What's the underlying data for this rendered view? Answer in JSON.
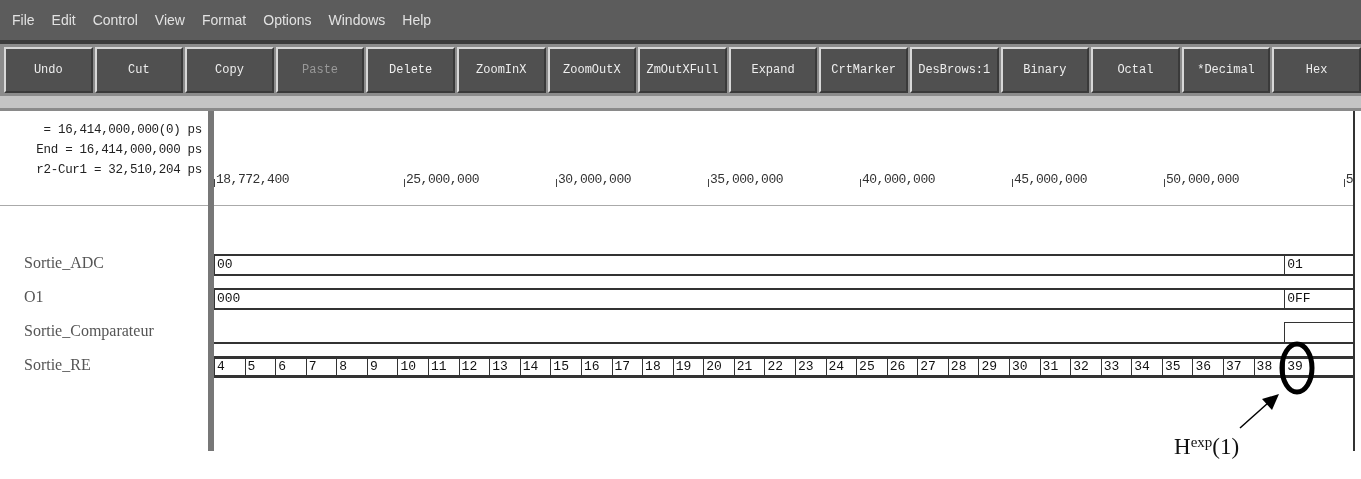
{
  "menu": [
    "File",
    "Edit",
    "Control",
    "View",
    "Format",
    "Options",
    "Windows",
    "Help"
  ],
  "toolbar": [
    {
      "label": "Undo",
      "disabled": false
    },
    {
      "label": "Cut",
      "disabled": false
    },
    {
      "label": "Copy",
      "disabled": false
    },
    {
      "label": "Paste",
      "disabled": true
    },
    {
      "label": "Delete",
      "disabled": false
    },
    {
      "label": "ZoomInX",
      "disabled": false
    },
    {
      "label": "ZoomOutX",
      "disabled": false
    },
    {
      "label": "ZmOutXFull",
      "disabled": false
    },
    {
      "label": "Expand",
      "disabled": false
    },
    {
      "label": "CrtMarker",
      "disabled": false
    },
    {
      "label": "DesBrows:1",
      "disabled": false
    },
    {
      "label": "Binary",
      "disabled": false
    },
    {
      "label": "Octal",
      "disabled": false
    },
    {
      "label": "*Decimal",
      "disabled": false
    },
    {
      "label": "Hex",
      "disabled": false
    }
  ],
  "cursor_info": [
    "= 16,414,000,000(0) ps",
    "End = 16,414,000,000 ps",
    "r2-Cur1 = 32,510,204 ps"
  ],
  "timeline": {
    "ticks": [
      "18,772,400",
      "25,000,000",
      "30,000,000",
      "35,000,000",
      "40,000,000",
      "45,000,000",
      "50,000,000",
      "5"
    ]
  },
  "signals": [
    {
      "name": "Sortie_ADC",
      "kind": "bus",
      "selected": false,
      "segments": [
        "00",
        "01"
      ]
    },
    {
      "name": "O1",
      "kind": "bus",
      "selected": false,
      "segments": [
        "000",
        "0FF"
      ]
    },
    {
      "name": "Sortie_Comparateur",
      "kind": "bit",
      "selected": false,
      "segments": [
        {
          "high": false
        },
        {
          "high": true
        }
      ]
    },
    {
      "name": "Sortie_RE",
      "kind": "bus",
      "selected": true,
      "segments": [
        "4",
        "5",
        "6",
        "7",
        "8",
        "9",
        "10",
        "11",
        "12",
        "13",
        "14",
        "15",
        "16",
        "17",
        "18",
        "19",
        "20",
        "21",
        "22",
        "23",
        "24",
        "25",
        "26",
        "27",
        "28",
        "29",
        "30",
        "31",
        "32",
        "33",
        "34",
        "35",
        "36",
        "37",
        "38",
        "39"
      ]
    }
  ],
  "annotation": {
    "label": "H$^{exp}$(1)"
  }
}
